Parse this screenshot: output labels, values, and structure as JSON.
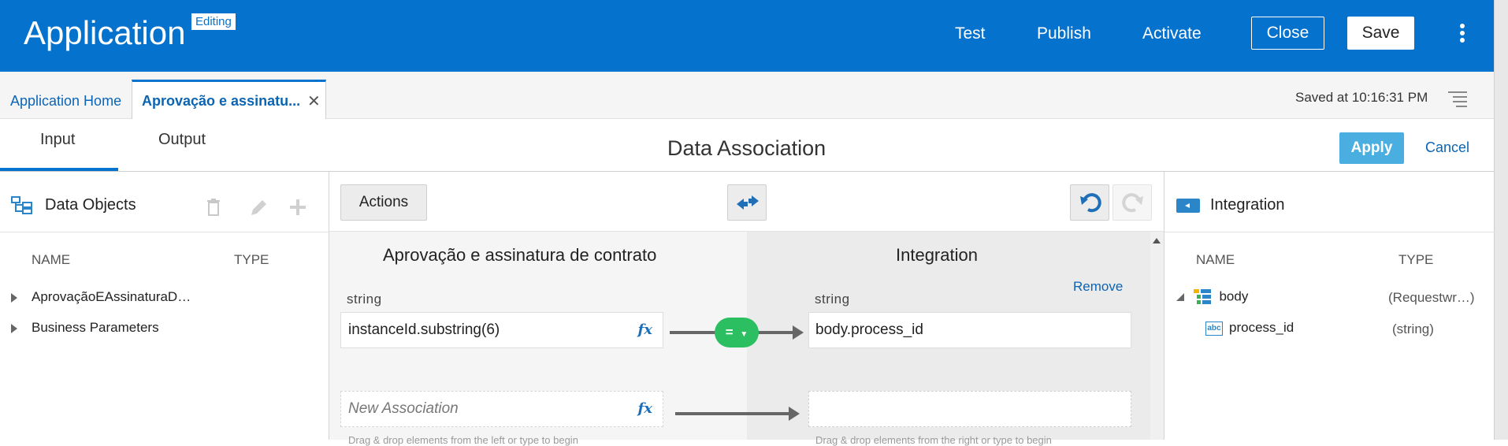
{
  "header": {
    "app_title": "Application",
    "mode_badge": "Editing",
    "nav": [
      "Test",
      "Publish",
      "Activate"
    ],
    "close_label": "Close",
    "save_label": "Save",
    "brand_color": "#0572ce"
  },
  "tabs": {
    "home": "Application Home",
    "active": "Aprovação e assinatu...",
    "close_glyph": "✕",
    "saved_status": "Saved at 10:16:31 PM"
  },
  "subheader": {
    "tabs": [
      "Input",
      "Output"
    ],
    "selected_tab": "Input",
    "title": "Data Association",
    "apply_label": "Apply",
    "cancel_label": "Cancel"
  },
  "left_panel": {
    "title": "Data Objects",
    "icons": [
      "data-objects-icon",
      "delete-icon",
      "edit-icon",
      "add-icon"
    ],
    "columns": [
      "NAME",
      "TYPE"
    ],
    "items": [
      {
        "name": "AprovaçãoEAssinaturaD…",
        "type": ""
      },
      {
        "name": "Business Parameters",
        "type": ""
      }
    ]
  },
  "center": {
    "actions_label": "Actions",
    "source_title": "Aprovação e assinatura de contrato",
    "target_title": "Integration",
    "remove_label": "Remove",
    "mappings": [
      {
        "source_type": "string",
        "source_expr": "instanceId.substring(6)",
        "operator": "=",
        "target_type": "string",
        "target_expr": "body.process_id"
      }
    ],
    "new_association_placeholder": "New Association",
    "fx_label": "fx",
    "hint_left": "Drag & drop elements from the left or type to begin",
    "hint_right": "Drag & drop elements from the right or type to begin"
  },
  "right_panel": {
    "title": "Integration",
    "columns": [
      "NAME",
      "TYPE"
    ],
    "tree": [
      {
        "name": "body",
        "type": "(Requestwr…)",
        "icon": "structure-icon",
        "expanded": true
      },
      {
        "name": "process_id",
        "type": "(string)",
        "icon": "string-type-icon"
      }
    ],
    "abc_glyph": "abc"
  }
}
